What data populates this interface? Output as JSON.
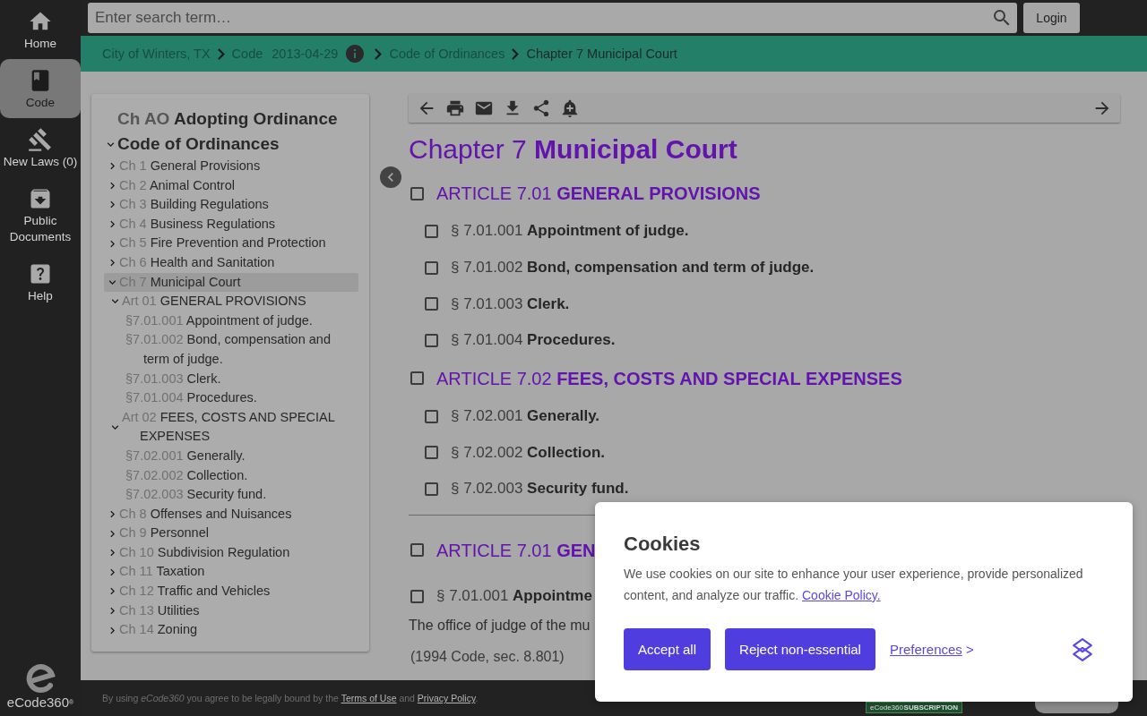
{
  "nav": {
    "items": [
      {
        "label": "Home",
        "selected": false
      },
      {
        "label": "Code",
        "selected": true
      },
      {
        "label": "New Laws (0)",
        "selected": false
      },
      {
        "label": "Public Documents",
        "selected": false
      },
      {
        "label": "Help",
        "selected": false
      }
    ],
    "logo_text": "eCode360$^{®}$"
  },
  "search": {
    "placeholder": "Enter search term…",
    "button": "Login"
  },
  "breadcrumbs": [
    {
      "label": "City of Winters, TX",
      "current": false
    },
    {
      "label": "Code",
      "date": "2013-04-29",
      "current": false
    },
    {
      "label": "Code of Ordinances",
      "current": false
    },
    {
      "label": "Chapter 7 Municipal Court",
      "current": true
    }
  ],
  "toc": {
    "items": [
      {
        "number": "Ch AO",
        "title": "Adopting Ordinance",
        "selected": false
      },
      {
        "title": "Code of Ordinances",
        "expanded": true,
        "selected": false,
        "children": [
          {
            "number": "Ch 1",
            "title": "General Provisions",
            "expanded": false,
            "selected": false
          },
          {
            "number": "Ch 2",
            "title": "Animal Control",
            "expanded": false,
            "selected": false
          },
          {
            "number": "Ch 3",
            "title": "Building Regulations",
            "expanded": false,
            "selected": false
          },
          {
            "number": "Ch 4",
            "title": "Business Regulations",
            "expanded": false,
            "selected": false
          },
          {
            "number": "Ch 5",
            "title": "Fire Prevention and Protection",
            "expanded": false,
            "selected": false
          },
          {
            "number": "Ch 6",
            "title": "Health and Sanitation",
            "expanded": false,
            "selected": false
          },
          {
            "number": "Ch 7",
            "title": "Municipal Court",
            "expanded": true,
            "selected": true,
            "children": [
              {
                "number": "Art 01",
                "title": "GENERAL PROVISIONS",
                "expanded": true,
                "selected": false,
                "children": [
                  {
                    "number": "§7.01.001",
                    "title": "Appointment of judge.",
                    "selected": false
                  },
                  {
                    "number": "§7.01.002",
                    "title": "Bond, compensation and term of judge.",
                    "selected": false
                  },
                  {
                    "number": "§7.01.003",
                    "title": "Clerk.",
                    "selected": false
                  },
                  {
                    "number": "§7.01.004",
                    "title": "Procedures.",
                    "selected": false
                  }
                ]
              },
              {
                "number": "Art 02",
                "title": "FEES, COSTS AND SPECIAL EXPENSES",
                "expanded": true,
                "selected": false,
                "children": [
                  {
                    "number": "§7.02.001",
                    "title": "Generally.",
                    "selected": false
                  },
                  {
                    "number": "§7.02.002",
                    "title": "Collection.",
                    "selected": false
                  },
                  {
                    "number": "§7.02.003",
                    "title": "Security fund.",
                    "selected": false
                  }
                ]
              }
            ]
          },
          {
            "number": "Ch 8",
            "title": "Offenses and Nuisances",
            "expanded": false,
            "selected": false
          },
          {
            "number": "Ch 9",
            "title": "Personnel",
            "expanded": false,
            "selected": false
          },
          {
            "number": "Ch 10",
            "title": "Subdivision Regulation",
            "expanded": false,
            "selected": false
          },
          {
            "number": "Ch 11",
            "title": "Taxation",
            "expanded": false,
            "selected": false
          },
          {
            "number": "Ch 12",
            "title": "Traffic and Vehicles",
            "expanded": false,
            "selected": false
          },
          {
            "number": "Ch 13",
            "title": "Utilities",
            "expanded": false,
            "selected": false
          },
          {
            "number": "Ch 14",
            "title": "Zoning",
            "expanded": false,
            "selected": false
          }
        ]
      }
    ]
  },
  "content": {
    "title": {
      "number": "Chapter 7",
      "name": "Municipal Court"
    },
    "articles": [
      {
        "number": "ARTICLE 7.01",
        "title": "GENERAL PROVISIONS",
        "checked": false,
        "sections": [
          {
            "number": "§ 7.01.001",
            "title": "Appointment of judge.",
            "checked": false
          },
          {
            "number": "§ 7.01.002",
            "title": "Bond, compensation and term of judge.",
            "checked": false
          },
          {
            "number": "§ 7.01.003",
            "title": "Clerk.",
            "checked": false
          },
          {
            "number": "§ 7.01.004",
            "title": "Procedures.",
            "checked": false
          }
        ]
      },
      {
        "number": "ARTICLE 7.02",
        "title": "FEES, COSTS AND SPECIAL EXPENSES",
        "checked": false,
        "sections": [
          {
            "number": "§ 7.02.001",
            "title": "Generally.",
            "checked": false
          },
          {
            "number": "§ 7.02.002",
            "title": "Collection.",
            "checked": false
          },
          {
            "number": "§ 7.02.003",
            "title": "Security fund.",
            "checked": false
          }
        ]
      }
    ],
    "body": {
      "article": {
        "number": "ARTICLE 7.01",
        "title": "GEN",
        "checked": false
      },
      "section": {
        "number": "§ 7.01.001",
        "title": "Appointme",
        "checked": false
      },
      "paragraph": "The office of judge of the mu",
      "history": "(1994 Code, sec. 8.801)"
    }
  },
  "footer": {
    "notice": "By using *eCode360* you agree to be legally bound by the",
    "terms": "Terms of Use",
    "joiner": "and",
    "privacy": "Privacy Policy",
    "end": ".",
    "badge": {
      "brand": "eCode360",
      "label": "SUBSCRIPTION"
    }
  },
  "cookie_banner": {
    "title": "Cookies",
    "text": "We use cookies on our site to enhance your user experience, provide personalized content, and analyze our traffic.",
    "policy_link": "Cookie Policy.",
    "buttons": [
      "Accept all",
      "Reject non-essential"
    ],
    "preferences": {
      "label": "Preferences",
      "suffix": ">"
    }
  }
}
